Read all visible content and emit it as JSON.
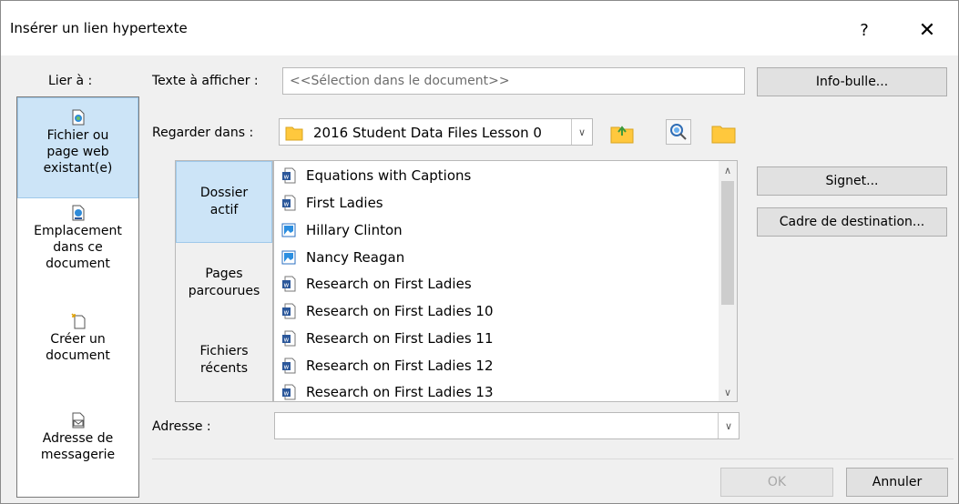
{
  "dialog": {
    "title": "Insérer un lien hypertexte",
    "help_label": "?",
    "close_label": "✕"
  },
  "nav": {
    "label": "Lier à :",
    "items": [
      {
        "lines": [
          "Fichier ou",
          "page web",
          "existant(e)"
        ],
        "icon": "existing-file-icon",
        "selected": true
      },
      {
        "lines": [
          "Emplacement",
          "dans ce",
          "document"
        ],
        "icon": "place-in-document-icon",
        "selected": false
      },
      {
        "lines": [
          "Créer un",
          "document"
        ],
        "icon": "new-document-icon",
        "selected": false
      },
      {
        "lines": [
          "Adresse de",
          "messagerie"
        ],
        "icon": "email-address-icon",
        "selected": false
      }
    ]
  },
  "text_to_display": {
    "label": "Texte à afficher :",
    "value": "<<Sélection dans le document>>"
  },
  "look_in": {
    "label": "Regarder dans :",
    "value": "2016 Student Data Files Lesson 0"
  },
  "sidetabs": [
    {
      "lines": [
        "Dossier",
        "actif"
      ],
      "selected": true
    },
    {
      "lines": [
        "Pages",
        "parcourues"
      ],
      "selected": false
    },
    {
      "lines": [
        "Fichiers",
        "récents"
      ],
      "selected": false
    }
  ],
  "files": [
    {
      "name": "Equations with Captions",
      "type": "word"
    },
    {
      "name": "First Ladies",
      "type": "word"
    },
    {
      "name": "Hillary Clinton",
      "type": "image"
    },
    {
      "name": "Nancy Reagan",
      "type": "image"
    },
    {
      "name": "Research on First Ladies",
      "type": "word"
    },
    {
      "name": "Research on First Ladies 10",
      "type": "word"
    },
    {
      "name": "Research on First Ladies 11",
      "type": "word"
    },
    {
      "name": "Research on First Ladies 12",
      "type": "word"
    },
    {
      "name": "Research on First Ladies 13",
      "type": "word"
    }
  ],
  "address": {
    "label": "Adresse :",
    "value": ""
  },
  "buttons": {
    "screentip": "Info-bulle...",
    "bookmark": "Signet...",
    "target_frame": "Cadre de destination...",
    "ok": "OK",
    "cancel": "Annuler"
  },
  "colors": {
    "selection": "#cce4f7",
    "word_blue": "#2b579a",
    "folder_yellow": "#ffc83d"
  }
}
